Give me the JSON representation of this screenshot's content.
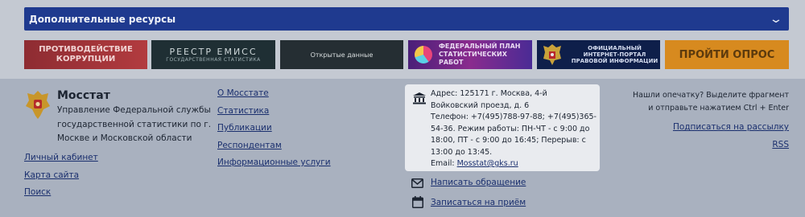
{
  "resources": {
    "title": "Дополнительные ресурсы",
    "banners": [
      {
        "icon": "none",
        "text": "ПРОТИВОДЕЙСТВИЕ КОРРУПЦИИ"
      },
      {
        "icon": "none",
        "title": "РЕЕСТР ЕМИСС",
        "subtitle": "ГОСУДАРСТВЕННАЯ СТАТИСТИКА"
      },
      {
        "icon": "none",
        "text": "Открытые данные"
      },
      {
        "icon": "pie-chart-icon",
        "text": "ФЕДЕРАЛЬНЫЙ ПЛАН СТАТИСТИЧЕСКИХ РАБОТ"
      },
      {
        "icon": "coat-of-arms-icon",
        "text": "ОФИЦИАЛЬНЫЙ ИНТЕРНЕТ-ПОРТАЛ ПРАВОВОЙ ИНФОРМАЦИИ"
      },
      {
        "icon": "none",
        "text": "ПРОЙТИ ОПРОС"
      }
    ]
  },
  "org": {
    "name": "Мосстат",
    "description": "Управление Федеральной службы государственной статистики по г. Москве и Московской области"
  },
  "left_links": [
    "Личный кабинет",
    "Карта сайта",
    "Поиск"
  ],
  "middle_links": [
    "О Мосстате",
    "Статистика",
    "Публикации",
    "Респондентам",
    "Информационные услуги"
  ],
  "contact": {
    "address": "Адрес: 125171 г. Москва, 4-й Войковский проезд, д. 6",
    "phone_hours": "Телефон: +7(495)788-97-88; +7(495)365-54-36. Режим работы: ПН-ЧТ - с 9:00 до 18:00, ПТ - с 9:00 до 16:45; Перерыв: с 13:00 до 13:45.",
    "email_label": "Email:",
    "email": "Mosstat@gks.ru"
  },
  "actions": {
    "write": "Написать обращение",
    "appointment": "Записаться на приём"
  },
  "right": {
    "typo_line1": "Нашли опечатку? Выделите фрагмент",
    "typo_line2": "и отправьте нажатием Ctrl + Enter",
    "subscribe": "Подписаться на рассылку",
    "rss": "RSS"
  },
  "colors": {
    "resources_bar": "#1f3a8f",
    "page_bg": "#a9b1bf",
    "link": "#1a2f6e"
  }
}
